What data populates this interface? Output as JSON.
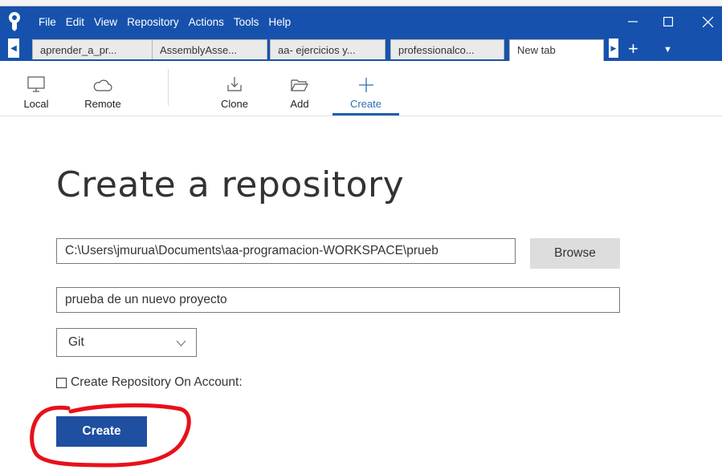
{
  "menu": [
    "File",
    "Edit",
    "View",
    "Repository",
    "Actions",
    "Tools",
    "Help"
  ],
  "tabs": [
    {
      "label": "aprender_a_pr..."
    },
    {
      "label": "AssemblyAsse..."
    },
    {
      "label": "aa- ejercicios y..."
    },
    {
      "label": "professionalco..."
    },
    {
      "label": "New tab",
      "active": true
    }
  ],
  "toolbar": {
    "local": "Local",
    "remote": "Remote",
    "clone": "Clone",
    "add": "Add",
    "create": "Create"
  },
  "main": {
    "title": "Create a repository",
    "path_value": "C:\\Users\\jmurua\\Documents\\aa-programacion-WORKSPACE\\prueb",
    "browse_label": "Browse",
    "name_value": "prueba de un nuevo proyecto",
    "type_selected": "Git",
    "checkbox_label": "Create Repository On Account:",
    "checkbox_checked": false,
    "create_label": "Create"
  },
  "colors": {
    "titlebar": "#1652ad",
    "accent": "#1f4fa1",
    "annotation": "#e8101a"
  },
  "icons": {
    "app": "sourcetree-logo-icon",
    "minimize": "minimize-icon",
    "maximize": "maximize-icon",
    "close": "close-icon",
    "local": "monitor-icon",
    "remote": "cloud-icon",
    "clone": "download-tray-icon",
    "add": "folder-open-icon",
    "create": "plus-icon"
  }
}
